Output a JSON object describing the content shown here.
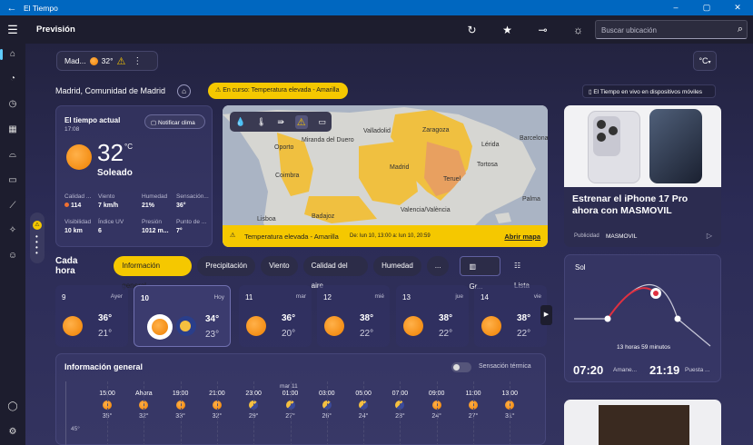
{
  "window": {
    "title": "El Tiempo"
  },
  "header": {
    "app_title": "Previsión",
    "search_placeholder": "Buscar ubicación"
  },
  "location_chip": {
    "name": "Mad...",
    "temp": "32°"
  },
  "unit_button": "°C",
  "location": {
    "full_name": "Madrid, Comunidad de Madrid"
  },
  "alert_pill": "En curso: Temperatura elevada - Amarilla",
  "live_pill": "El Tiempo en vivo en dispositivos móviles",
  "current": {
    "title": "El tiempo actual",
    "time": "17:08",
    "notify": "Notificar clima",
    "temp": "32",
    "unit": "°C",
    "condition": "Soleado",
    "details": [
      {
        "label": "Calidad ...",
        "value": "114"
      },
      {
        "label": "Viento",
        "value": "7 km/h"
      },
      {
        "label": "Humedad",
        "value": "21%"
      },
      {
        "label": "Sensación...",
        "value": "36°"
      },
      {
        "label": "Visibilidad",
        "value": "10 km"
      },
      {
        "label": "Índice UV",
        "value": "6"
      },
      {
        "label": "Presión",
        "value": "1012 m..."
      },
      {
        "label": "Punto de ...",
        "value": "7°"
      }
    ]
  },
  "map": {
    "cities": [
      "Oporto",
      "Miranda del Duero",
      "Valladolid",
      "Zaragoza",
      "Lérida",
      "Barcelona",
      "Coimbra",
      "Madrid",
      "Tortosa",
      "Teruel",
      "Valencia/València",
      "Lisboa",
      "Badajoz",
      "Palma"
    ],
    "alert_text": "Temperatura elevada - Amarilla",
    "alert_date": "De: lun 10, 13:00 a: lun 10, 20:59",
    "open_map": "Abrir mapa"
  },
  "promo": {
    "title": "Estrenar el iPhone 17 Pro ahora con MASMOVIL",
    "tag": "Publicidad",
    "brand": "MASMOVIL"
  },
  "hourly": {
    "title": "Cada hora",
    "tabs": [
      "Información general",
      "Precipitación",
      "Viento",
      "Calidad del aire",
      "Humedad",
      "..."
    ],
    "view_graph": "Gr...",
    "view_list": "Lista"
  },
  "days": [
    {
      "day": "9",
      "weekday": "Ayer",
      "hi": "36°",
      "lo": "21°"
    },
    {
      "day": "10",
      "weekday": "Hoy",
      "hi": "34°",
      "lo": "23°"
    },
    {
      "day": "11",
      "weekday": "mar",
      "hi": "36°",
      "lo": "20°"
    },
    {
      "day": "12",
      "weekday": "mié",
      "hi": "38°",
      "lo": "22°"
    },
    {
      "day": "13",
      "weekday": "jue",
      "hi": "38°",
      "lo": "22°"
    },
    {
      "day": "14",
      "weekday": "vie",
      "hi": "38°",
      "lo": "22°"
    }
  ],
  "info": {
    "title": "Información general",
    "toggle_label": "Sensación térmica",
    "date_label": "mar 11",
    "axis_label": "45°",
    "hours": [
      {
        "t": "15:00",
        "v": "35°"
      },
      {
        "t": "Ahora",
        "v": "32°"
      },
      {
        "t": "19:00",
        "v": "33°"
      },
      {
        "t": "21:00",
        "v": "32°"
      },
      {
        "t": "23:00",
        "v": "29°"
      },
      {
        "t": "01:00",
        "v": "27°"
      },
      {
        "t": "03:00",
        "v": "26°"
      },
      {
        "t": "05:00",
        "v": "24°"
      },
      {
        "t": "07:00",
        "v": "23°"
      },
      {
        "t": "09:00",
        "v": "24°"
      },
      {
        "t": "11:00",
        "v": "27°"
      },
      {
        "t": "13:00",
        "v": "31°"
      }
    ]
  },
  "sun": {
    "title": "Sol",
    "duration": "13 horas 59 minutos",
    "sunrise": "07:20",
    "sunrise_label": "Amane...",
    "sunset": "21:19",
    "sunset_label": "Puesta ..."
  },
  "colors": {
    "accent": "#f5c800",
    "titlebar": "#0067c0",
    "sun": "#f08000"
  }
}
